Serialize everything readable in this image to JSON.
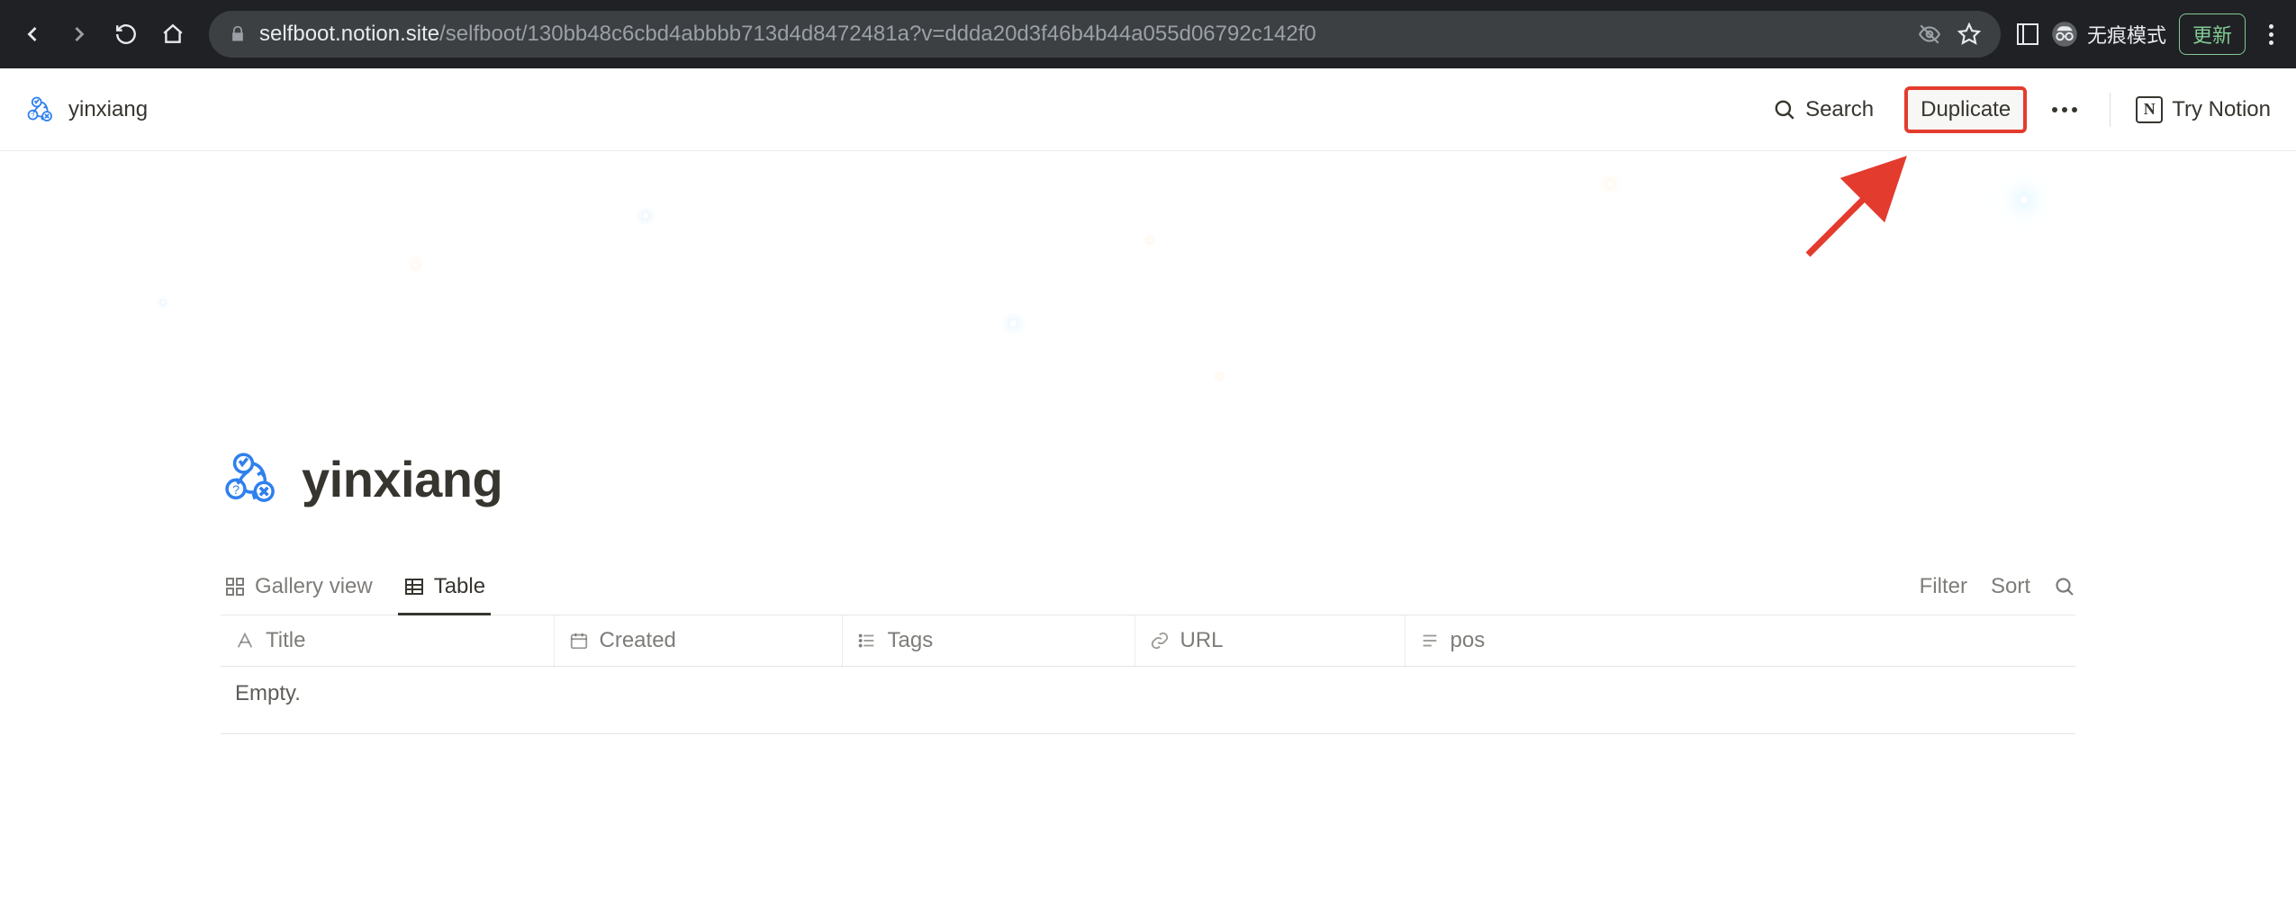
{
  "browser": {
    "url_host": "selfboot.notion.site",
    "url_path": "/selfboot/130bb48c6cbd4abbbb713d4d8472481a?v=ddda20d3f46b4b44a055d06792c142f0",
    "incognito_label": "无痕模式",
    "update_label": "更新"
  },
  "topbar": {
    "title": "yinxiang",
    "search_label": "Search",
    "duplicate_label": "Duplicate",
    "try_notion_label": "Try Notion"
  },
  "page": {
    "title": "yinxiang"
  },
  "views": {
    "tabs": [
      {
        "label": "Gallery view",
        "active": false
      },
      {
        "label": "Table",
        "active": true
      }
    ],
    "filter_label": "Filter",
    "sort_label": "Sort"
  },
  "table": {
    "columns": [
      {
        "label": "Title",
        "type": "title"
      },
      {
        "label": "Created",
        "type": "created"
      },
      {
        "label": "Tags",
        "type": "tags"
      },
      {
        "label": "URL",
        "type": "url"
      },
      {
        "label": "pos",
        "type": "text"
      }
    ],
    "empty_label": "Empty."
  },
  "colors": {
    "annotation_red": "#e33b2e",
    "notion_text": "#37352f",
    "muted": "rgba(55,53,47,0.65)",
    "icon_blue": "#2f80ed"
  }
}
